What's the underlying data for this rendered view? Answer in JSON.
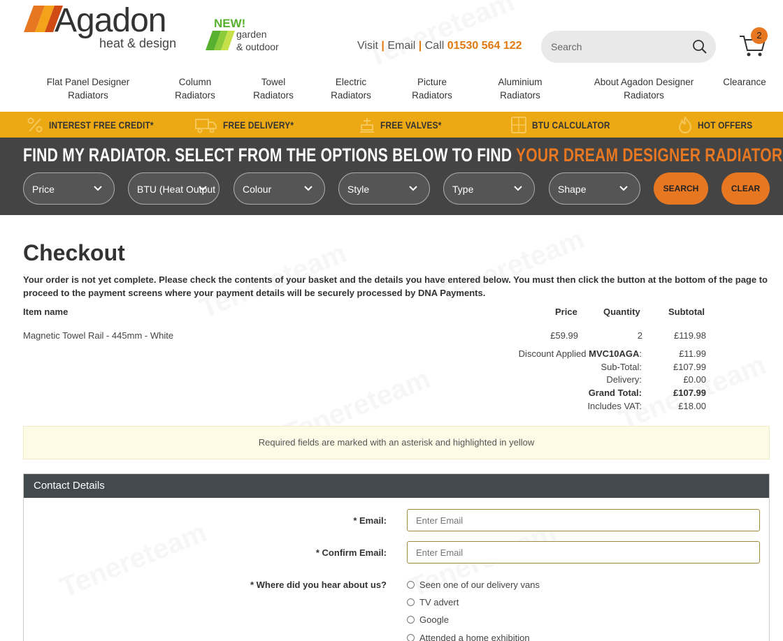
{
  "brand": {
    "name": "Agadon",
    "tagline": "heat & design",
    "colors": {
      "orange": "#e87722",
      "yellow_bar": "#eca914",
      "dark_band": "#444444",
      "green": "#58b030"
    }
  },
  "garden": {
    "new": "NEW!",
    "line1": "garden",
    "line2": "& outdoor"
  },
  "contact": {
    "visit": "Visit",
    "email": "Email",
    "call": "Call",
    "phone": "01530 564 122"
  },
  "search": {
    "placeholder": "Search",
    "icon": "search-icon"
  },
  "cart": {
    "count": "2",
    "icon": "cart-icon"
  },
  "nav": [
    {
      "line1": "Flat Panel Designer",
      "line2": "Radiators"
    },
    {
      "line1": "Column",
      "line2": "Radiators"
    },
    {
      "line1": "Towel",
      "line2": "Radiators"
    },
    {
      "line1": "Electric",
      "line2": "Radiators"
    },
    {
      "line1": "Picture",
      "line2": "Radiators"
    },
    {
      "line1": "Aluminium",
      "line2": "Radiators"
    },
    {
      "line1": "About Agadon Designer",
      "line2": "Radiators"
    },
    {
      "line1": "Clearance",
      "line2": ""
    }
  ],
  "promos": [
    {
      "label": "Interest Free Credit*",
      "icon": "percent-icon"
    },
    {
      "label": "Free Delivery*",
      "icon": "truck-icon"
    },
    {
      "label": "Free Valves*",
      "icon": "valve-icon"
    },
    {
      "label": "BTU Calculator",
      "icon": "calculator-icon"
    },
    {
      "label": "Hot Offers",
      "icon": "flame-icon"
    }
  ],
  "finder": {
    "title_main": "FIND MY RADIATOR. SELECT FROM THE OPTIONS BELOW TO FIND ",
    "title_highlight": "YOUR DREAM DESIGNER RADIATOR.",
    "filters": [
      "Price",
      "BTU (Heat Output",
      "Colour",
      "Style",
      "Type",
      "Shape"
    ],
    "search_label": "SEARCH",
    "clear_label": "CLEAR"
  },
  "checkout": {
    "title": "Checkout",
    "intro": "Your order is not yet complete. Please check the contents of your basket and the details you have entered below. You must then click the button at the bottom of the page to proceed to the payment screens where your payment details will be securely processed by DNA Payments.",
    "headers": {
      "item": "Item name",
      "price": "Price",
      "quantity": "Quantity",
      "subtotal": "Subtotal"
    },
    "items": [
      {
        "name": "Magnetic Towel Rail - 445mm - White",
        "price": "£59.99",
        "quantity": "2",
        "subtotal": "£119.98"
      }
    ],
    "summary": {
      "discount_prefix": "Discount Applied ",
      "discount_code": "MVC10AGA",
      "discount_suffix": ":",
      "discount_value": "£11.99",
      "subtotal_label": "Sub-Total:",
      "subtotal_value": "£107.99",
      "delivery_label": "Delivery:",
      "delivery_value": "£0.00",
      "grand_label": "Grand Total:",
      "grand_value": "£107.99",
      "vat_label": "Includes VAT:",
      "vat_value": "£18.00"
    },
    "notice": "Required fields are marked with an asterisk and highlighted in yellow"
  },
  "contact_form": {
    "title": "Contact Details",
    "email_label": "* Email:",
    "email_placeholder": "Enter Email",
    "confirm_label": "* Confirm Email:",
    "confirm_placeholder": "Enter Email",
    "hear_label": "* Where did you hear about us?",
    "hear_options": [
      "Seen one of our delivery vans",
      "TV advert",
      "Google",
      "Attended a home exhibition"
    ]
  },
  "watermark": "Tenereteam"
}
